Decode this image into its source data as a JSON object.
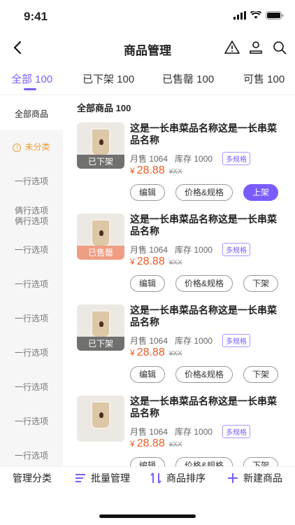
{
  "status_bar": {
    "time": "9:41"
  },
  "header": {
    "title": "商品管理"
  },
  "tabs": [
    {
      "label": "全部 100"
    },
    {
      "label": "已下架 100"
    },
    {
      "label": "已售罄 100"
    },
    {
      "label": "可售 100"
    }
  ],
  "sidebar": {
    "items": [
      {
        "label": "全部商品"
      },
      {
        "label": "未分类"
      },
      {
        "label": "一行选项"
      },
      {
        "label": "俩行选项\n俩行选项"
      },
      {
        "label": "一行选项"
      },
      {
        "label": "一行选项"
      },
      {
        "label": "一行选项"
      },
      {
        "label": "一行选项"
      },
      {
        "label": "一行选项"
      },
      {
        "label": "一行选项"
      },
      {
        "label": "一行选项"
      }
    ]
  },
  "main": {
    "section_title": "全部商品 100",
    "products": [
      {
        "name": "这是一长串菜品名称这是一长串菜品名称",
        "sales": "月售 1064",
        "stock": "库存 1000",
        "spec_badge": "多规格",
        "price": "28.88",
        "currency": "¥",
        "old_price": "¥XX",
        "image_tag": "已下架",
        "actions": [
          "编辑",
          "价格&规格",
          "上架"
        ]
      },
      {
        "name": "这是一长串菜品名称这是一长串菜品名称",
        "sales": "月售 1064",
        "stock": "库存 1000",
        "spec_badge": "多规格",
        "price": "28.88",
        "currency": "¥",
        "old_price": "¥XX",
        "image_tag": "已售罄",
        "actions": [
          "编辑",
          "价格&规格",
          "下架"
        ]
      },
      {
        "name": "这是一长串菜品名称这是一长串菜品名称",
        "sales": "月售 1064",
        "stock": "库存 1000",
        "spec_badge": "多规格",
        "price": "28.88",
        "currency": "¥",
        "old_price": "¥XX",
        "image_tag": "已下架",
        "actions": [
          "编辑",
          "价格&规格",
          "下架"
        ]
      },
      {
        "name": "这是一长串菜品名称这是一长串菜品名称",
        "sales": "月售 1064",
        "stock": "库存 1000",
        "spec_badge": "多规格",
        "price": "28.88",
        "currency": "¥",
        "old_price": "¥XX",
        "image_tag": "",
        "actions": [
          "编辑",
          "价格&规格",
          "下架"
        ]
      }
    ]
  },
  "bottom_bar": {
    "manage_category": "管理分类",
    "batch_manage": "批量管理",
    "sort_products": "商品排序",
    "new_product": "新建商品"
  },
  "colors": {
    "accent": "#7b5cff",
    "price": "#f05a24",
    "warning": "#f29b30"
  }
}
